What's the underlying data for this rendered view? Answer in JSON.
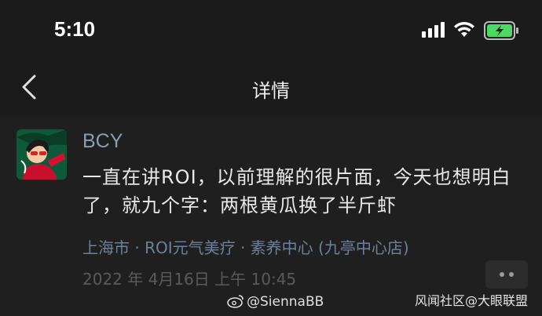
{
  "status_bar": {
    "time": "5:10",
    "icons": [
      "signal-icon",
      "wifi-icon",
      "battery-charging-icon"
    ],
    "battery_color": "#4cd964"
  },
  "nav": {
    "back_icon": "chevron-left-icon",
    "title": "详情"
  },
  "post": {
    "username": "BCY",
    "text": "一直在讲ROI，以前理解的很片面，今天也想明白了，就九个字：两根黄瓜换了半斤虾",
    "location": "上海市 · ROI元气美疗 · 素养中心 (九亭中心店)",
    "timestamp": "2022 年 4月16日 上午 10:45",
    "more_icon": "more-dots-icon"
  },
  "watermarks": {
    "weibo": "@SiennaBB",
    "community": "风闻社区@大眼联盟"
  },
  "colors": {
    "background": "#1b1b1b",
    "username": "#8c9bb6",
    "location": "#6f7f9c",
    "timestamp": "#5a5a5a"
  }
}
